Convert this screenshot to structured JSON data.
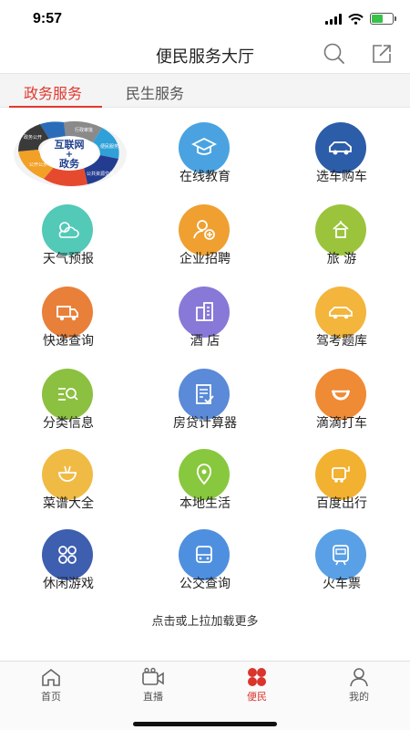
{
  "status_bar": {
    "time": "9:57"
  },
  "nav": {
    "title": "便民服务大厅"
  },
  "tabs": [
    {
      "label": "政务服务",
      "active": true
    },
    {
      "label": "民生服务",
      "active": false
    }
  ],
  "logo": {
    "center_line1": "互联网",
    "center_line2": "+",
    "center_line3": "政务",
    "petals": [
      "行政审批",
      "便民服务",
      "公共资源交易",
      "公开公示",
      "政务公开"
    ]
  },
  "services": [
    {
      "label": "在线教育",
      "icon": "graduation-cap-icon",
      "color": "#4aa3e0"
    },
    {
      "label": "选车购车",
      "icon": "car-icon",
      "color": "#2c5da8"
    },
    {
      "label": "天气预报",
      "icon": "weather-icon",
      "color": "#53c9b8"
    },
    {
      "label": "企业招聘",
      "icon": "recruit-icon",
      "color": "#f0a030"
    },
    {
      "label": "旅 游",
      "icon": "travel-icon",
      "color": "#9bc43c"
    },
    {
      "label": "快递查询",
      "icon": "delivery-truck-icon",
      "color": "#e8803a"
    },
    {
      "label": "酒 店",
      "icon": "hotel-icon",
      "color": "#8878d8"
    },
    {
      "label": "驾考题库",
      "icon": "driving-test-icon",
      "color": "#f3b53b"
    },
    {
      "label": "分类信息",
      "icon": "category-info-icon",
      "color": "#8cc040"
    },
    {
      "label": "房贷计算器",
      "icon": "calculator-icon",
      "color": "#5a8ad8"
    },
    {
      "label": "滴滴打车",
      "icon": "didi-icon",
      "color": "#ef8a35"
    },
    {
      "label": "菜谱大全",
      "icon": "recipe-icon",
      "color": "#f0bb45"
    },
    {
      "label": "本地生活",
      "icon": "location-pin-icon",
      "color": "#88c83e"
    },
    {
      "label": "百度出行",
      "icon": "bus-stop-icon",
      "color": "#f2b131"
    },
    {
      "label": "休闲游戏",
      "icon": "game-icon",
      "color": "#3e5eb0"
    },
    {
      "label": "公交查询",
      "icon": "bus-icon",
      "color": "#4f8fe0"
    },
    {
      "label": "火车票",
      "icon": "train-icon",
      "color": "#5aa0e6"
    }
  ],
  "load_more": "点击或上拉加载更多",
  "bottom_tabs": [
    {
      "label": "首页",
      "icon": "home-icon",
      "active": false
    },
    {
      "label": "直播",
      "icon": "live-camera-icon",
      "active": false
    },
    {
      "label": "便民",
      "icon": "flower-icon",
      "active": true
    },
    {
      "label": "我的",
      "icon": "profile-icon",
      "active": false
    }
  ]
}
